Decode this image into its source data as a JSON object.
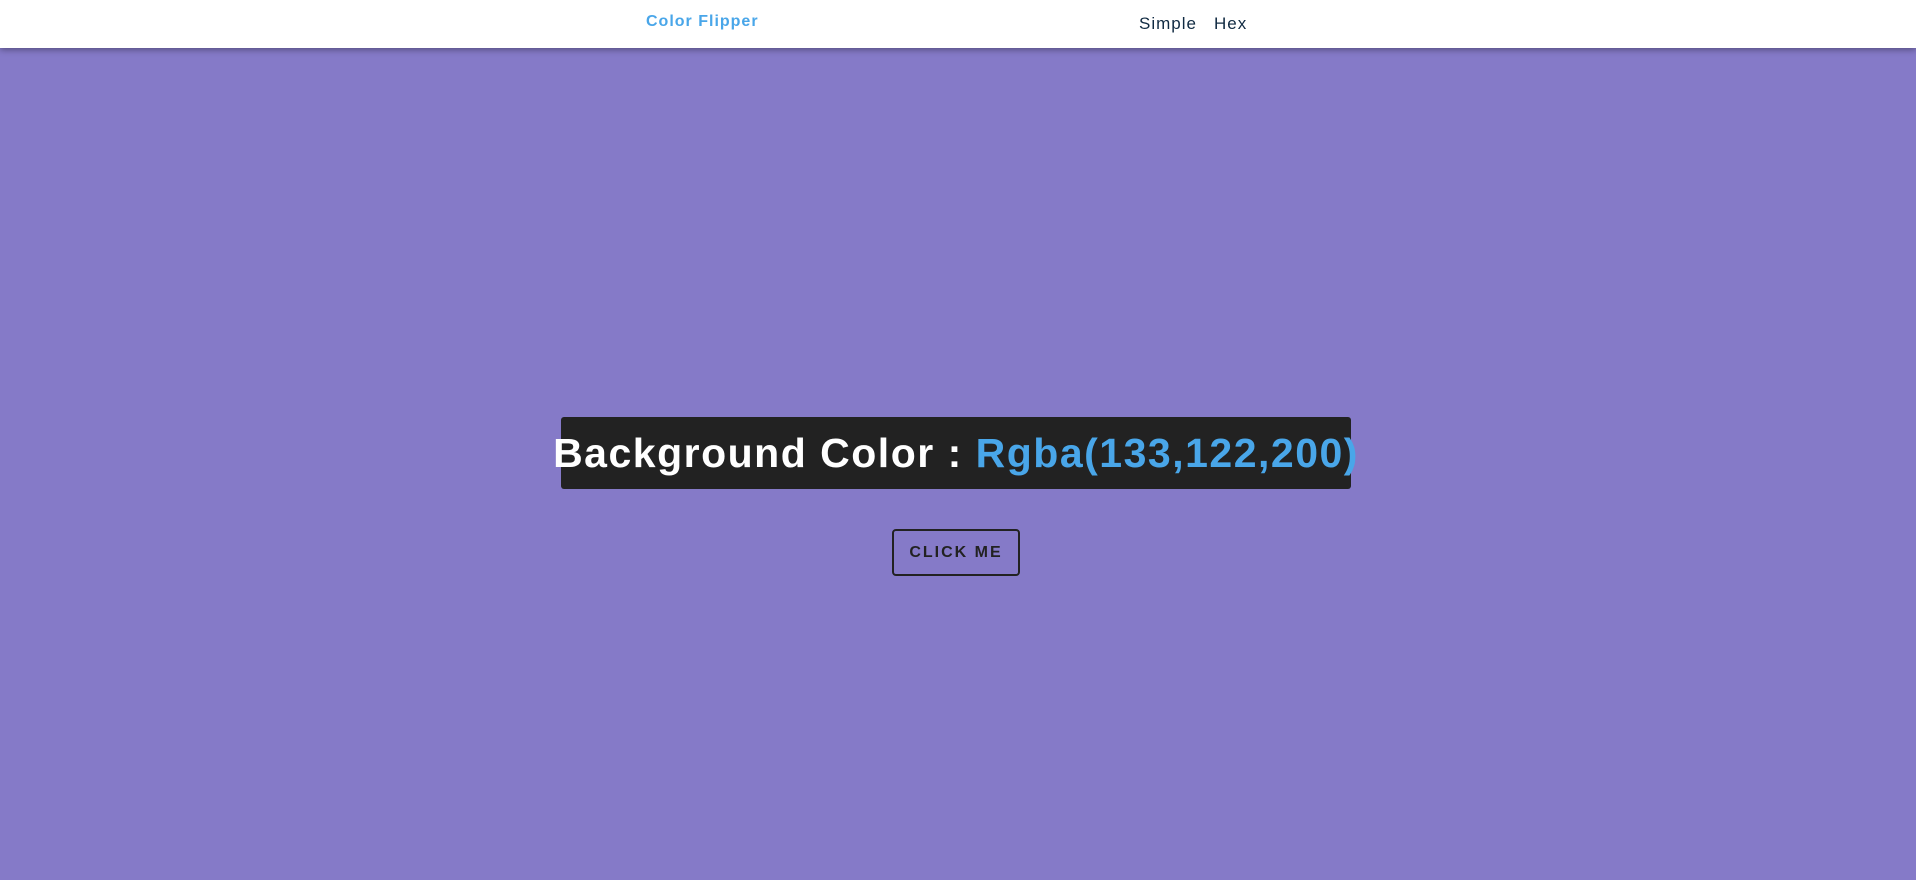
{
  "navbar": {
    "brand": "Color Flipper",
    "links": [
      {
        "label": "Simple"
      },
      {
        "label": "Hex"
      }
    ]
  },
  "main": {
    "heading_prefix": "Background Color : ",
    "color_value": "Rgba(133,122,200)",
    "button_label": "CLICK ME"
  },
  "colors": {
    "page_background": "#857ac8",
    "accent": "#49a6e9",
    "dark_box": "#222222",
    "nav_text": "#102a42"
  }
}
